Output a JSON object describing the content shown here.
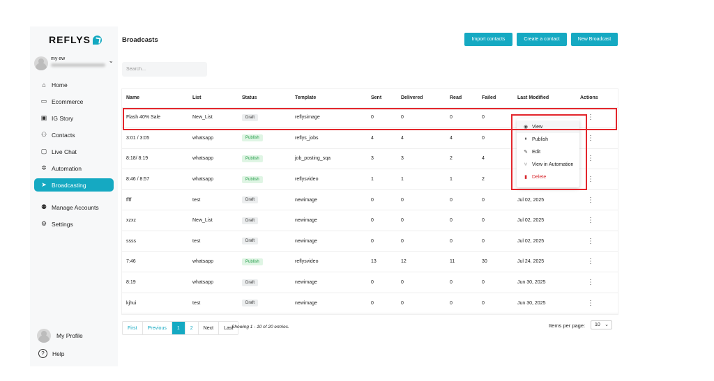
{
  "brand": {
    "name": "REFLYS"
  },
  "account": {
    "name": "my ew"
  },
  "sidebar": {
    "items": [
      {
        "label": "Home",
        "icon": "home-icon",
        "glyph": "⌂"
      },
      {
        "label": "Ecommerce",
        "icon": "store-icon",
        "glyph": "▭"
      },
      {
        "label": "IG Story",
        "icon": "image-icon",
        "glyph": "▣"
      },
      {
        "label": "Contacts",
        "icon": "users-icon",
        "glyph": "⚇"
      },
      {
        "label": "Live Chat",
        "icon": "chat-icon",
        "glyph": "▢"
      },
      {
        "label": "Automation",
        "icon": "automation-icon",
        "glyph": "✲"
      },
      {
        "label": "Broadcasting",
        "icon": "send-icon",
        "glyph": "➤"
      }
    ],
    "secondary": [
      {
        "label": "Manage Accounts",
        "icon": "user-cog-icon",
        "glyph": "⚉"
      },
      {
        "label": "Settings",
        "icon": "gear-icon",
        "glyph": "⚙"
      }
    ],
    "profile": "My Profile",
    "help": "Help",
    "active": "Broadcasting"
  },
  "header": {
    "title": "Broadcasts",
    "buttons": [
      "Import contacts",
      "Create a contact",
      "New Broadcast"
    ]
  },
  "search": {
    "placeholder": "Search..."
  },
  "table": {
    "columns": [
      "Name",
      "List",
      "Status",
      "Template",
      "Sent",
      "Delivered",
      "Read",
      "Failed",
      "Last Modified",
      "Actions"
    ],
    "rows": [
      {
        "name": "Flash 40% Sale",
        "list": "New_List",
        "status": "Draft",
        "template": "reflysimage",
        "sent": "0",
        "delivered": "0",
        "read": "0",
        "failed": "0",
        "modified": ""
      },
      {
        "name": "3:01 / 3:05",
        "list": "whatsapp",
        "status": "Publish",
        "template": "reflys_jobs",
        "sent": "4",
        "delivered": "4",
        "read": "4",
        "failed": "0",
        "modified": ""
      },
      {
        "name": "8:18/ 8:19",
        "list": "whatsapp",
        "status": "Publish",
        "template": "job_posting_sqa",
        "sent": "3",
        "delivered": "3",
        "read": "2",
        "failed": "4",
        "modified": ""
      },
      {
        "name": "8:46 / 8:57",
        "list": "whatsapp",
        "status": "Publish",
        "template": "reflysvideo",
        "sent": "1",
        "delivered": "1",
        "read": "1",
        "failed": "2",
        "modified": ""
      },
      {
        "name": "ffff",
        "list": "test",
        "status": "Draft",
        "template": "newimage",
        "sent": "0",
        "delivered": "0",
        "read": "0",
        "failed": "0",
        "modified": "Jul 02, 2025"
      },
      {
        "name": "xzxz",
        "list": "New_List",
        "status": "Draft",
        "template": "newimage",
        "sent": "0",
        "delivered": "0",
        "read": "0",
        "failed": "0",
        "modified": "Jul 02, 2025"
      },
      {
        "name": "ssss",
        "list": "test",
        "status": "Draft",
        "template": "newimage",
        "sent": "0",
        "delivered": "0",
        "read": "0",
        "failed": "0",
        "modified": "Jul 02, 2025"
      },
      {
        "name": "7:46",
        "list": "whatsapp",
        "status": "Publish",
        "template": "reflysvideo",
        "sent": "13",
        "delivered": "12",
        "read": "11",
        "failed": "30",
        "modified": "Jul 24, 2025"
      },
      {
        "name": "8:19",
        "list": "whatsapp",
        "status": "Draft",
        "template": "newimage",
        "sent": "0",
        "delivered": "0",
        "read": "0",
        "failed": "0",
        "modified": "Jun 30, 2025"
      },
      {
        "name": "kjhui",
        "list": "test",
        "status": "Draft",
        "template": "newimage",
        "sent": "0",
        "delivered": "0",
        "read": "0",
        "failed": "0",
        "modified": "Jun 30, 2025"
      }
    ]
  },
  "action_menu": {
    "items": [
      {
        "label": "View",
        "icon": "eye-icon",
        "glyph": "◉"
      },
      {
        "label": "Publish",
        "icon": "pause-icon",
        "glyph": "⏸"
      },
      {
        "label": "Edit",
        "icon": "pencil-icon",
        "glyph": "✎"
      },
      {
        "label": "View in Automation",
        "icon": "flow-icon",
        "glyph": "⑂"
      },
      {
        "label": "Delete",
        "icon": "trash-icon",
        "glyph": "▮"
      }
    ]
  },
  "pagination": {
    "first": "First",
    "previous": "Previous",
    "pages": [
      "1",
      "2"
    ],
    "next": "Next",
    "last": "Last",
    "current": "1",
    "showing": "Showing 1 - 10 of 20 entries.",
    "items_per_page_label": "Items per page:",
    "items_per_page": "10"
  },
  "colors": {
    "accent": "#15a9c2",
    "highlight": "#e3262c",
    "danger": "#d7262c",
    "publish": "#1f9a45"
  }
}
